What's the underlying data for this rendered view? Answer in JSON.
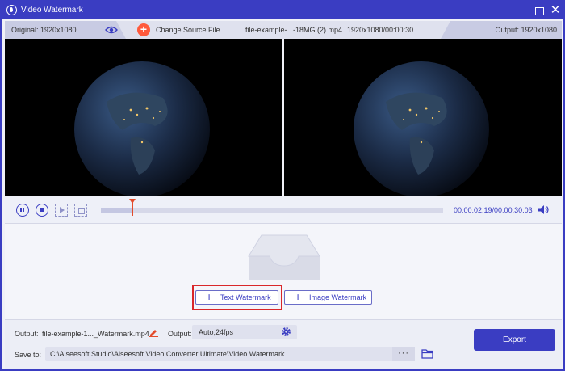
{
  "window": {
    "title": "Video Watermark",
    "icons": {
      "app": "droplet-icon",
      "maximize": "maximize-icon",
      "close": "close-icon",
      "close_glyph": "✕"
    },
    "accent": "#3a3dc2"
  },
  "infobar": {
    "original_label": "Original: 1920x1080",
    "change_source_label": "Change Source File",
    "change_source_glyph": "+",
    "file_name": "file-example-...-18MG (2).mp4",
    "file_resolution": "1920x1080/00:00:30",
    "output_label": "Output: 1920x1080"
  },
  "player": {
    "current_time": "00:00:02.19",
    "total_time": "/00:00:30.03",
    "progress_fraction": 0.091,
    "icons": [
      "pause-icon",
      "stop-icon",
      "next-frame-icon",
      "snapshot-icon",
      "volume-icon"
    ]
  },
  "watermark": {
    "text_button": "Text Watermark",
    "image_button": "Image Watermark",
    "plus_glyph": "+"
  },
  "output": {
    "output_label": "Output:",
    "file_name": "file-example-1..._Watermark.mp4",
    "format_label": "Output:",
    "format_value": "Auto;24fps",
    "save_label": "Save to:",
    "save_path": "C:\\Aiseesoft Studio\\Aiseesoft Video Converter Ultimate\\Video Watermark",
    "browse_label": "···",
    "export_label": "Export"
  }
}
